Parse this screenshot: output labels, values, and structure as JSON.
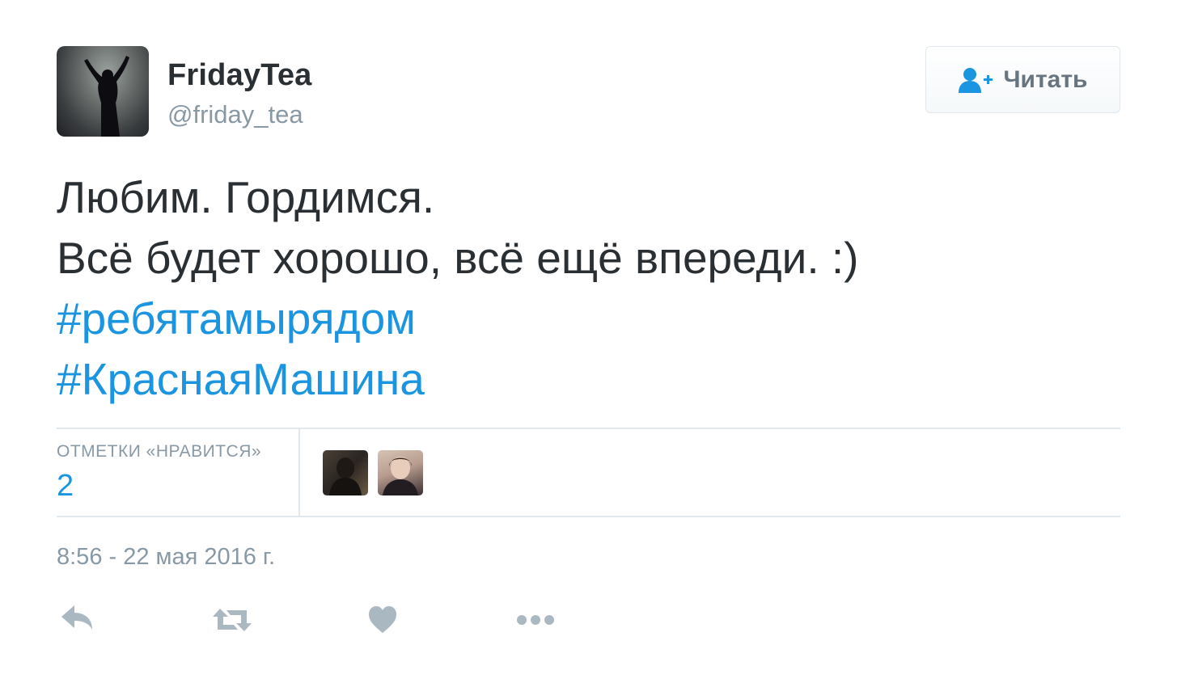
{
  "author": {
    "display_name": "FridayTea",
    "handle": "@friday_tea"
  },
  "follow_button": {
    "label": "Читать",
    "icon": "add-user-icon"
  },
  "tweet": {
    "lines": [
      "Любим. Гордимся.",
      "Всё будет хорошо, всё ещё впереди. :)"
    ],
    "hashtags": [
      "#ребятамырядом",
      "#КраснаяМашина"
    ]
  },
  "stats": {
    "likes_label": "ОТМЕТКИ «НРАВИТСЯ»",
    "likes_count": "2"
  },
  "timestamp": "8:56 - 22 мая 2016 г.",
  "actions": [
    "reply-icon",
    "retweet-icon",
    "heart-icon",
    "more-icon"
  ],
  "colors": {
    "link": "#1b95e0",
    "text": "#292f33",
    "muted": "#8899a6",
    "border": "#e1e8ed",
    "action_icon": "#aab8c2"
  }
}
